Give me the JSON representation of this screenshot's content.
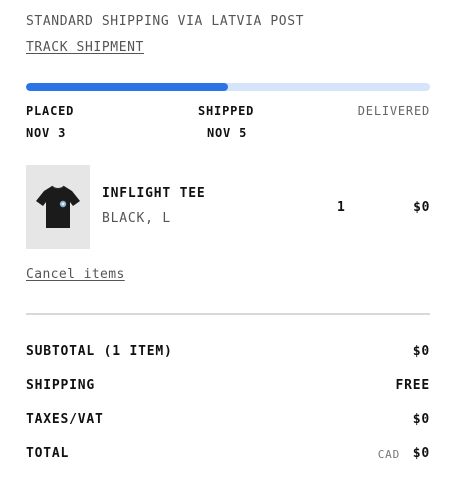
{
  "shipment": {
    "method": "STANDARD SHIPPING VIA LATVIA POST",
    "track_label": "TRACK SHIPMENT",
    "progress": 0.5,
    "progress_color": "#2b74e6",
    "progress_track_color": "#d6e4fb",
    "steps": [
      {
        "label": "PLACED",
        "date": "NOV 3"
      },
      {
        "label": "SHIPPED",
        "date": "NOV 5"
      },
      {
        "label": "DELIVERED",
        "date": ""
      }
    ]
  },
  "item": {
    "name": "INFLIGHT TEE",
    "variant": "BLACK, L",
    "quantity": "1",
    "price": "$0",
    "image_icon": "black-tshirt-icon"
  },
  "actions": {
    "cancel_label": "Cancel items"
  },
  "summary": {
    "subtotal_label": "SUBTOTAL (1 ITEM)",
    "subtotal_value": "$0",
    "shipping_label": "SHIPPING",
    "shipping_value": "FREE",
    "taxes_label": "TAXES/VAT",
    "taxes_value": "$0",
    "total_label": "TOTAL",
    "total_currency": "CAD",
    "total_value": "$0"
  }
}
